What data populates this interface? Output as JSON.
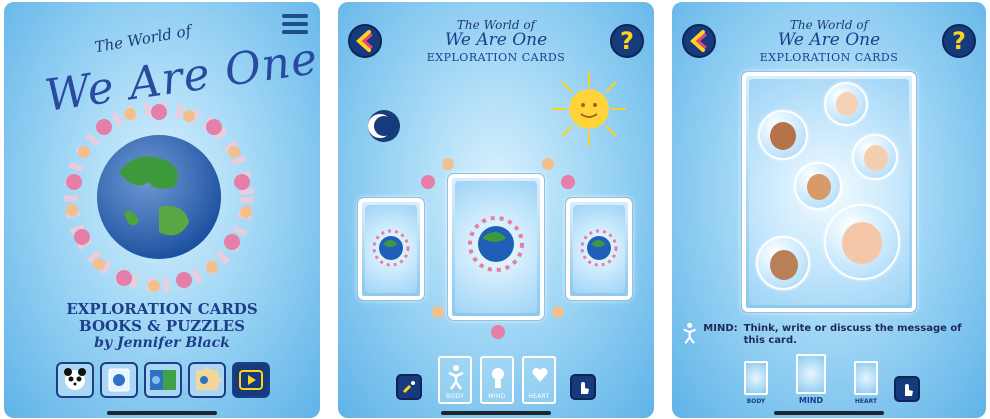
{
  "screens": [
    {
      "title_small": "The World of",
      "title_big": "We Are One",
      "line1": "EXPLORATION CARDS",
      "line2": "BOOKS & PUZZLES",
      "author": "by Jennifer Black",
      "icons": [
        "menu-icon",
        "panda-icon",
        "cards-icon",
        "books-icon",
        "puzzle-icon",
        "play-icon"
      ]
    },
    {
      "title_small": "The World of",
      "title_big": "We Are One",
      "subtitle": "EXPLORATION CARDS",
      "categories": [
        "BODY",
        "MIND",
        "HEART"
      ],
      "icons": [
        "back-icon",
        "help-icon",
        "moon-icon",
        "sun-icon",
        "shuffle-icon",
        "hand-tap-icon"
      ]
    },
    {
      "title_small": "The World of",
      "title_big": "We Are One",
      "subtitle": "EXPLORATION CARDS",
      "mind_label": "MIND:",
      "mind_text": "Think, write or discuss the message of this card.",
      "categories": [
        "BODY",
        "MIND",
        "HEART"
      ],
      "icons": [
        "back-icon",
        "help-icon",
        "person-icon",
        "hand-tap-icon"
      ]
    }
  ],
  "colors": {
    "accent": "#163b7d",
    "title": "#1d3f8a",
    "icon_yellow": "#ffd21f",
    "sky": "#5fb3e8"
  }
}
